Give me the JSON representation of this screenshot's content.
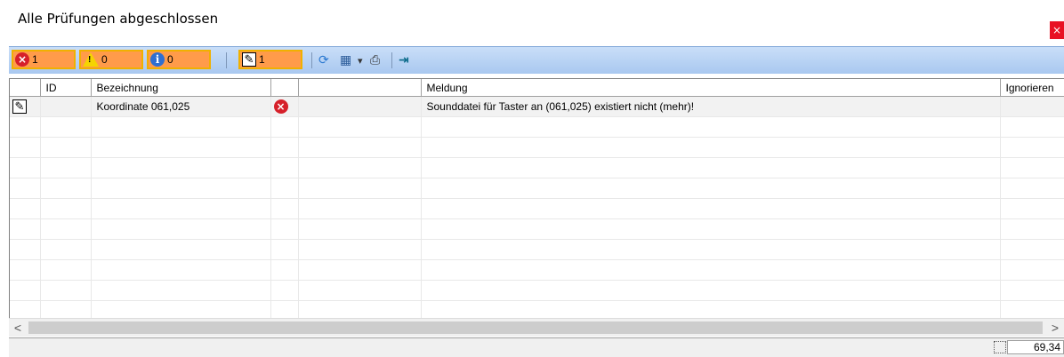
{
  "window": {
    "title": "Alle Prüfungen abgeschlossen",
    "close_label": "×"
  },
  "toolbar": {
    "errors": {
      "icon": "error-icon",
      "count": "1"
    },
    "warnings": {
      "icon": "warning-icon",
      "count": "0"
    },
    "infos": {
      "icon": "info-icon",
      "count": "0"
    },
    "edits": {
      "icon": "edit-icon",
      "count": "1"
    },
    "refresh_icon": "refresh-icon",
    "columns_icon": "columns-icon",
    "dropdown_glyph": "▾",
    "print_icon": "print-icon",
    "export_icon": "export-icon"
  },
  "table": {
    "columns": [
      "",
      "ID",
      "Bezeichnung",
      "",
      "",
      "Meldung",
      "Ignorieren"
    ],
    "rows": [
      {
        "icon": "edit-icon",
        "id": "",
        "bezeichnung": "Koordinate 061,025",
        "status_icon": "error-icon",
        "extra": "",
        "meldung": "Sounddatei für Taster an (061,025) existiert nicht (mehr)!",
        "ignorieren": ""
      }
    ]
  },
  "scrollbar": {
    "left_arrow": "<",
    "right_arrow": ">"
  },
  "status": {
    "value": "69,34"
  },
  "colors": {
    "toolbar_button_fill": "#ff9b4a",
    "toolbar_button_border": "#f0b000",
    "toolbar_bg": "#b8d3f4",
    "error_red": "#d6202a",
    "close_red": "#e81123"
  }
}
